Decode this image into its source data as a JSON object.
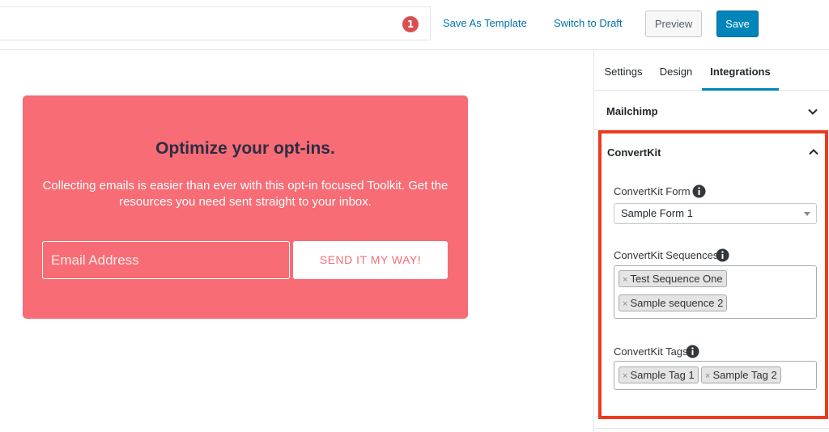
{
  "header": {
    "notification_count": "1",
    "save_as_template": "Save As Template",
    "switch_to_draft": "Switch to Draft",
    "preview": "Preview",
    "save": "Save"
  },
  "optin": {
    "title": "Optimize your opt-ins.",
    "description": "Collecting emails is easier than ever with this opt-in focused Toolkit. Get the resources you need sent straight to your inbox.",
    "email_placeholder": "Email Address",
    "submit_label": "SEND IT MY WAY!",
    "background_color": "#f76c75"
  },
  "sidebar": {
    "tabs": [
      {
        "label": "Settings",
        "active": false
      },
      {
        "label": "Design",
        "active": false
      },
      {
        "label": "Integrations",
        "active": true
      }
    ],
    "panels": {
      "mailchimp": {
        "title": "Mailchimp",
        "expanded": false
      },
      "convertkit": {
        "title": "ConvertKit",
        "expanded": true,
        "highlight_color": "#ec3b1f",
        "form": {
          "label": "ConvertKit Form",
          "value": "Sample Form 1"
        },
        "sequences": {
          "label": "ConvertKit Sequences",
          "items": [
            "Test Sequence One",
            "Sample sequence 2"
          ]
        },
        "tags": {
          "label": "ConvertKit Tags",
          "items": [
            "Sample Tag 1",
            "Sample Tag 2"
          ]
        }
      }
    }
  },
  "icons": {
    "chevron_down": "chevron-down-icon",
    "chevron_up": "chevron-up-icon",
    "info": "info-icon",
    "remove": "remove-chip-icon"
  },
  "colors": {
    "accent": "#0085ba",
    "link": "#0073aa",
    "badge": "#d94f4f"
  }
}
